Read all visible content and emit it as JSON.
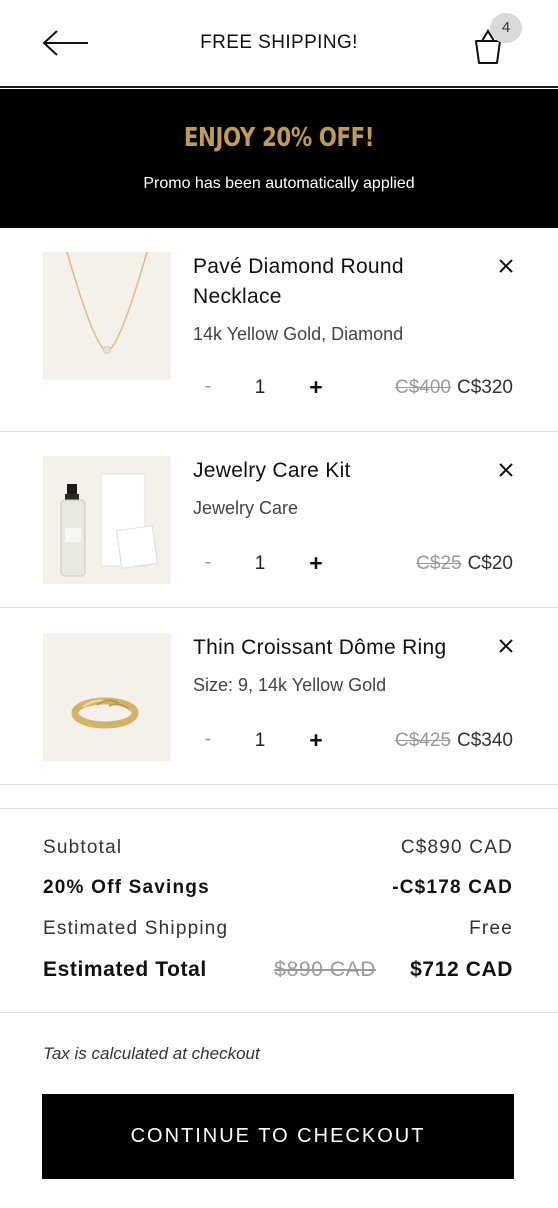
{
  "header": {
    "title": "FREE SHIPPING!",
    "cart_count": "4"
  },
  "promo": {
    "title": "ENJOY 20% OFF!",
    "subtitle": "Promo has been automatically applied"
  },
  "items": [
    {
      "name": "Pavé Diamond Round Necklace",
      "variant": "14k Yellow Gold, Diamond",
      "quantity": "1",
      "minus_label": "-",
      "plus_label": "+",
      "original_price": "C$400",
      "price": "C$320",
      "image_icon": "necklace-image"
    },
    {
      "name": "Jewelry Care Kit",
      "variant": "Jewelry Care",
      "quantity": "1",
      "minus_label": "-",
      "plus_label": "+",
      "original_price": "C$25",
      "price": "C$20",
      "image_icon": "care-kit-image"
    },
    {
      "name": "Thin Croissant Dôme Ring",
      "variant": "Size: 9, 14k Yellow Gold",
      "quantity": "1",
      "minus_label": "-",
      "plus_label": "+",
      "original_price": "C$425",
      "price": "C$340",
      "image_icon": "ring-image"
    }
  ],
  "summary": {
    "subtotal_label": "Subtotal",
    "subtotal_value": "C$890 CAD",
    "savings_label": "20% Off Savings",
    "savings_value": "-C$178 CAD",
    "shipping_label": "Estimated Shipping",
    "shipping_value": "Free",
    "total_label": "Estimated Total",
    "total_original": "$890 CAD",
    "total_value": "$712 CAD"
  },
  "tax_note": "Tax is calculated at checkout",
  "checkout_label": "CONTINUE TO CHECKOUT",
  "colors": {
    "promo_gold": "#c09a57",
    "banner_bg": "#000000",
    "button_bg": "#000000"
  }
}
